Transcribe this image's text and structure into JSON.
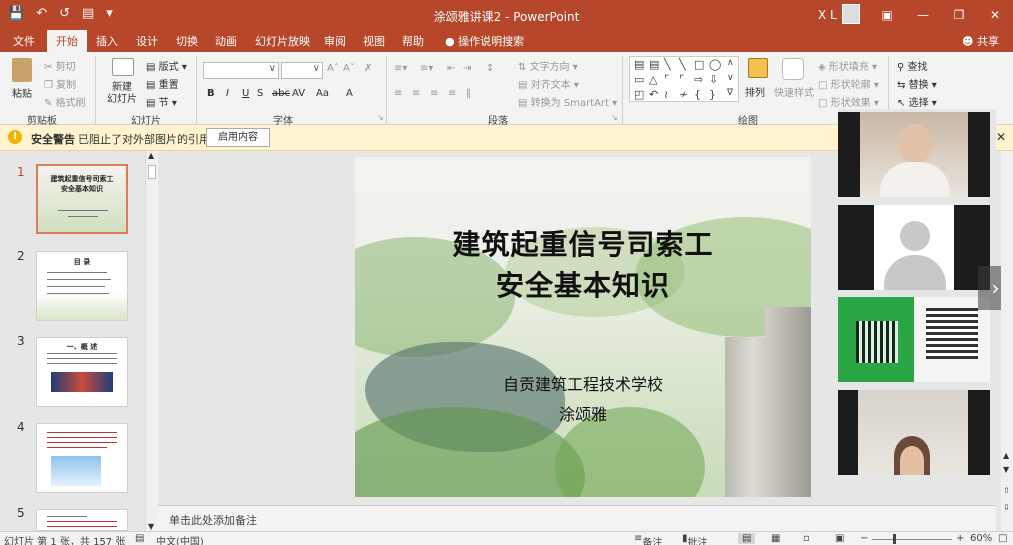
{
  "window": {
    "title": "涂颂雅讲课2 - PowerPoint",
    "user_initials": "X L",
    "quick_access": [
      "save-icon",
      "undo-icon",
      "redo-icon",
      "present-icon",
      "customize-icon"
    ]
  },
  "tabs": [
    {
      "label": "文件"
    },
    {
      "label": "开始"
    },
    {
      "label": "插入"
    },
    {
      "label": "设计"
    },
    {
      "label": "切换"
    },
    {
      "label": "动画"
    },
    {
      "label": "幻灯片放映"
    },
    {
      "label": "审阅"
    },
    {
      "label": "视图"
    },
    {
      "label": "帮助"
    }
  ],
  "active_tab": "开始",
  "tell_me": "操作说明搜索",
  "share": "共享",
  "ribbon": {
    "clipboard": {
      "group": "剪贴板",
      "paste": "粘贴",
      "cut": "剪切",
      "copy": "复制",
      "format_painter": "格式刷"
    },
    "slides": {
      "group": "幻灯片",
      "new_slide": "新建\n幻灯片",
      "layout": "版式",
      "reset": "重置",
      "section": "节"
    },
    "font": {
      "group": "字体",
      "bold": "B",
      "italic": "I",
      "underline": "U",
      "strike": "S",
      "abc": "abc",
      "spacing": "AV",
      "case": "Aa",
      "color": "A"
    },
    "paragraph": {
      "group": "段落",
      "text_direction": "文字方向",
      "align_text": "对齐文本",
      "smartart": "转换为 SmartArt"
    },
    "drawing": {
      "group": "绘图",
      "arrange": "排列",
      "quick_styles": "快速样式",
      "shape_fill": "形状填充",
      "shape_outline": "形状轮廓",
      "shape_effects": "形状效果"
    },
    "editing": {
      "find": "查找",
      "replace": "替换",
      "select": "选择"
    }
  },
  "security": {
    "title": "安全警告",
    "message": "已阻止了对外部图片的引用",
    "button": "启用内容"
  },
  "thumbnails": [
    {
      "num": "1",
      "title": "建筑起重信号司索工\n安全基本知识",
      "selected": true
    },
    {
      "num": "2",
      "title": "目 录",
      "selected": false
    },
    {
      "num": "3",
      "title": "一、概 述",
      "selected": false
    },
    {
      "num": "4",
      "title": "",
      "selected": false
    },
    {
      "num": "5",
      "title": "",
      "selected": false
    }
  ],
  "slide": {
    "title_line1": "建筑起重信号司索工",
    "title_line2": "安全基本知识",
    "school": "自贡建筑工程技术学校",
    "author": "涂颂雅"
  },
  "notes_placeholder": "单击此处添加备注",
  "status": {
    "slide_info": "幻灯片 第 1 张，共 157 张",
    "language": "中文(中国)",
    "notes": "备注",
    "comments": "批注",
    "zoom": "60%"
  },
  "colors": {
    "accent": "#b7472a",
    "ribbon_bg": "#f3f3f3",
    "warning_bg": "#fff4ce"
  }
}
